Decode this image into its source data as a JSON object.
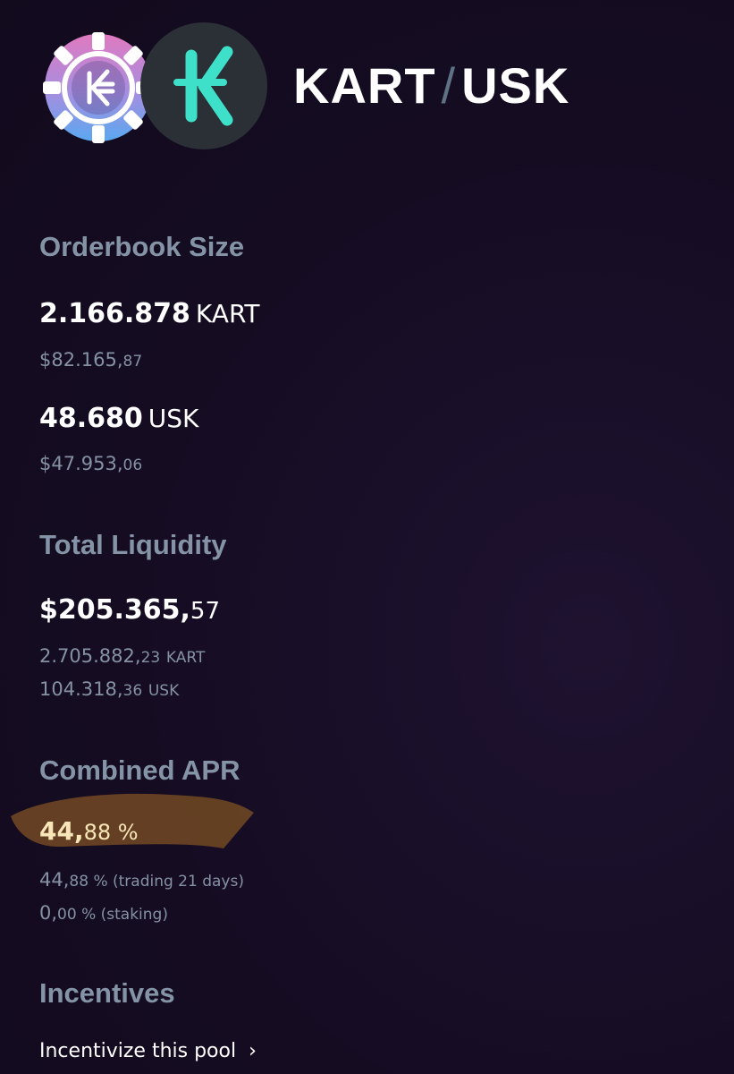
{
  "header": {
    "base_token": "KART",
    "separator": "/",
    "quote_token": "USK",
    "colors": {
      "chip_gradient_top": "#e07ac0",
      "chip_gradient_bottom": "#5aa8f0",
      "kuji_bg": "#2a3036",
      "kuji_accent": "#3fe0c9",
      "slash": "#5f7185"
    }
  },
  "orderbook": {
    "title": "Orderbook Size",
    "base": {
      "amount": "2.166.878",
      "unit": "KART",
      "usd_main": "$82.165,",
      "usd_dec": "87"
    },
    "quote": {
      "amount": "48.680",
      "unit": "USK",
      "usd_main": "$47.953,",
      "usd_dec": "06"
    }
  },
  "liquidity": {
    "title": "Total Liquidity",
    "total_main": "$205.365,",
    "total_dec": "57",
    "base_main": "2.705.882,",
    "base_dec": "23",
    "base_unit": "KART",
    "quote_main": "104.318,",
    "quote_dec": "36",
    "quote_unit": "USK"
  },
  "apr": {
    "title": "Combined APR",
    "combined_main": "44,",
    "combined_dec": "88 %",
    "trading_main": "44,",
    "trading_dec": "88 % (trading 21 days)",
    "staking_main": "0,",
    "staking_dec": "00 % (staking)",
    "highlight_color": "#6b4424"
  },
  "incentives": {
    "title": "Incentives",
    "link_label": "Incentivize this pool",
    "chevron": "›"
  }
}
